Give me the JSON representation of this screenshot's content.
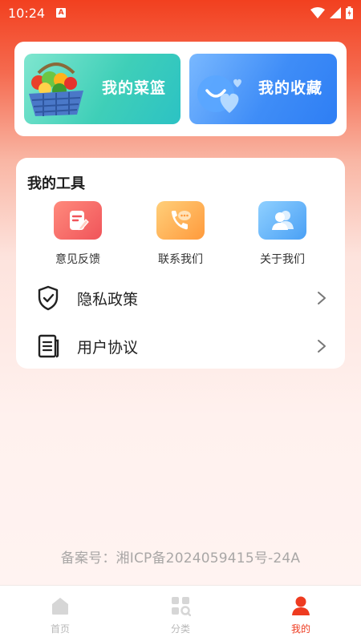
{
  "status_bar": {
    "time": "10:24",
    "notif_badge": "A"
  },
  "banners": {
    "basket": {
      "label": "我的菜篮",
      "icon": "vegetable-basket-icon"
    },
    "favorites": {
      "label": "我的收藏",
      "icon": "heart-bubbles-icon"
    }
  },
  "tools": {
    "title": "我的工具",
    "items": [
      {
        "label": "意见反馈",
        "icon": "feedback-edit-icon",
        "color": "#f0545a"
      },
      {
        "label": "联系我们",
        "icon": "phone-chat-icon",
        "color": "#ff9a3c"
      },
      {
        "label": "关于我们",
        "icon": "users-icon",
        "color": "#4aa0f5"
      }
    ]
  },
  "menu": {
    "privacy": {
      "label": "隐私政策",
      "icon": "shield-check-icon"
    },
    "agreement": {
      "label": "用户协议",
      "icon": "document-icon"
    }
  },
  "footer": {
    "icp": "备案号：湘ICP备2024059415号-24A"
  },
  "tabbar": {
    "items": [
      {
        "label": "首页",
        "icon": "home-icon",
        "active": false
      },
      {
        "label": "分类",
        "icon": "category-icon",
        "active": false
      },
      {
        "label": "我的",
        "icon": "profile-icon",
        "active": true
      }
    ]
  },
  "colors": {
    "accent": "#ee3b20",
    "header": "#f2401f"
  }
}
